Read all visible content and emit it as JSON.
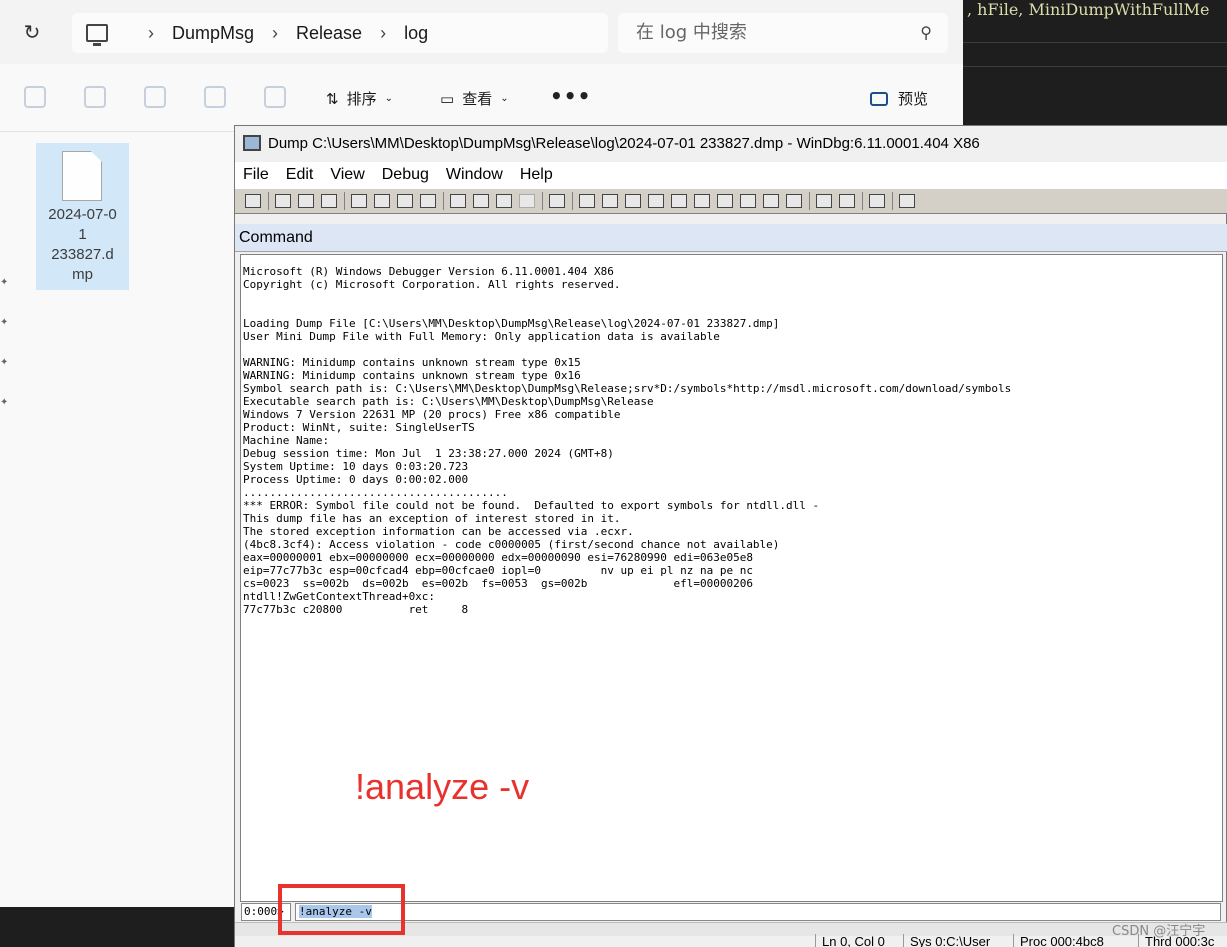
{
  "explorer": {
    "breadcrumb": [
      "DumpMsg",
      "Release",
      "log"
    ],
    "search_placeholder": "在 log 中搜索",
    "toolbar": {
      "sort_label": "排序",
      "view_label": "查看",
      "more_label": "•••",
      "preview_label": "预览"
    },
    "file": {
      "name": "2024-07-0\n1\n233827.d\nmp"
    }
  },
  "editor": {
    "code_text": ", hFile, MiniDumpWithFullMe"
  },
  "windbg": {
    "title": "Dump C:\\Users\\MM\\Desktop\\DumpMsg\\Release\\log\\2024-07-01 233827.dmp - WinDbg:6.11.0001.404 X86",
    "menu": [
      "File",
      "Edit",
      "View",
      "Debug",
      "Window",
      "Help"
    ],
    "command_header": "Command",
    "output_lines": [
      "Microsoft (R) Windows Debugger Version 6.11.0001.404 X86",
      "Copyright (c) Microsoft Corporation. All rights reserved.",
      "",
      "",
      "Loading Dump File [C:\\Users\\MM\\Desktop\\DumpMsg\\Release\\log\\2024-07-01 233827.dmp]",
      "User Mini Dump File with Full Memory: Only application data is available",
      "",
      "WARNING: Minidump contains unknown stream type 0x15",
      "WARNING: Minidump contains unknown stream type 0x16",
      "Symbol search path is: C:\\Users\\MM\\Desktop\\DumpMsg\\Release;srv*D:/symbols*http://msdl.microsoft.com/download/symbols",
      "Executable search path is: C:\\Users\\MM\\Desktop\\DumpMsg\\Release",
      "Windows 7 Version 22631 MP (20 procs) Free x86 compatible",
      "Product: WinNt, suite: SingleUserTS",
      "Machine Name:",
      "Debug session time: Mon Jul  1 23:38:27.000 2024 (GMT+8)",
      "System Uptime: 10 days 0:03:20.723",
      "Process Uptime: 0 days 0:00:02.000",
      "........................................",
      "*** ERROR: Symbol file could not be found.  Defaulted to export symbols for ntdll.dll -",
      "This dump file has an exception of interest stored in it.",
      "The stored exception information can be accessed via .ecxr.",
      "(4bc8.3cf4): Access violation - code c0000005 (first/second chance not available)",
      "eax=00000001 ebx=00000000 ecx=00000000 edx=00000090 esi=76280990 edi=063e05e8",
      "eip=77c77b3c esp=00cfcad4 ebp=00cfcae0 iopl=0         nv up ei pl nz na pe nc",
      "cs=0023  ss=002b  ds=002b  es=002b  fs=0053  gs=002b             efl=00000206",
      "ntdll!ZwGetContextThread+0xc:",
      "77c77b3c c20800          ret     8"
    ],
    "annotation": "!analyze -v",
    "prompt": "0:000>",
    "command_input": "!analyze -v",
    "status": [
      "Ln 0, Col 0",
      "Sys 0:C:\\User",
      "Proc 000:4bc8",
      "Thrd 000:3c"
    ]
  },
  "watermark": "CSDN @汪宁宇"
}
